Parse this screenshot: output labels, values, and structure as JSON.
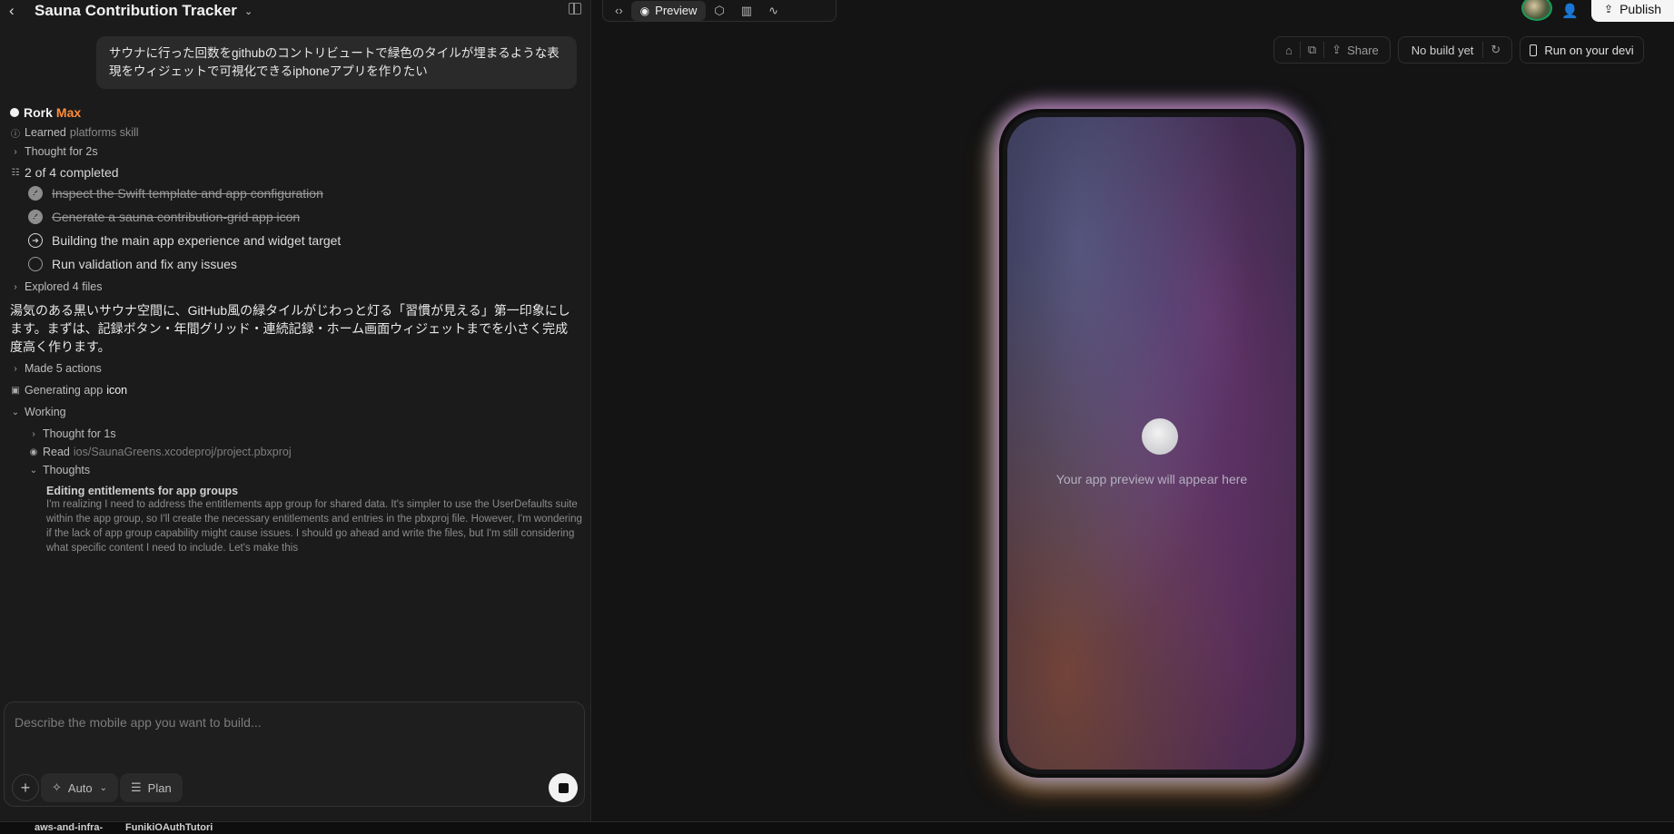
{
  "project": {
    "title": "Sauna Contribution Tracker"
  },
  "chat": {
    "user_message": "サウナに行った回数をgithubのコントリビュートで緑色のタイルが埋まるような表現をウィジェットで可視化できるiphoneアプリを作りたい",
    "agent_name": "Rork",
    "agent_tier": "Max",
    "learned_label": "Learned",
    "learned_skill": "platforms skill",
    "thought_2s": "Thought for 2s",
    "progress": "2 of 4 completed",
    "tasks": [
      {
        "label": "Inspect the Swift template and app configuration",
        "status": "done"
      },
      {
        "label": "Generate a sauna contribution-grid app icon",
        "status": "done"
      },
      {
        "label": "Building the main app experience and widget target",
        "status": "active"
      },
      {
        "label": "Run validation and fix any issues",
        "status": "todo"
      }
    ],
    "explored": "Explored 4 files",
    "paragraph": "湯気のある黒いサウナ空間に、GitHub風の緑タイルがじわっと灯る「習慣が見える」第一印象にします。まずは、記録ボタン・年間グリッド・連続記録・ホーム画面ウィジェットまでを小さく完成度高く作ります。",
    "actions": "Made 5 actions",
    "generating_label": "Generating app",
    "generating_object": "icon",
    "working": "Working",
    "thought_1s": "Thought for 1s",
    "read_label": "Read",
    "read_path": "ios/SaunaGreens.xcodeproj/project.pbxproj",
    "thoughts_label": "Thoughts",
    "thought_title": "Editing entitlements for app groups",
    "thought_body": "I'm realizing I need to address the entitlements app group for shared data. It's simpler to use the UserDefaults suite within the app group, so I'll create the necessary entitlements and entries in the pbxproj file. However, I'm wondering if the lack of app group capability might cause issues. I should go ahead and write the files, but I'm still considering what specific content I need to include. Let's make this"
  },
  "composer": {
    "placeholder": "Describe the mobile app you want to build...",
    "mode": "Auto",
    "plan": "Plan"
  },
  "tabs": {
    "preview": "Preview"
  },
  "header": {
    "publish": "Publish"
  },
  "toolbar": {
    "share": "Share",
    "build_status": "No build yet",
    "run": "Run on your devi"
  },
  "preview": {
    "placeholder": "Your app preview will appear here"
  },
  "bottom_tabs": [
    "aws-and-infra-",
    "FunikiOAuthTutori"
  ]
}
